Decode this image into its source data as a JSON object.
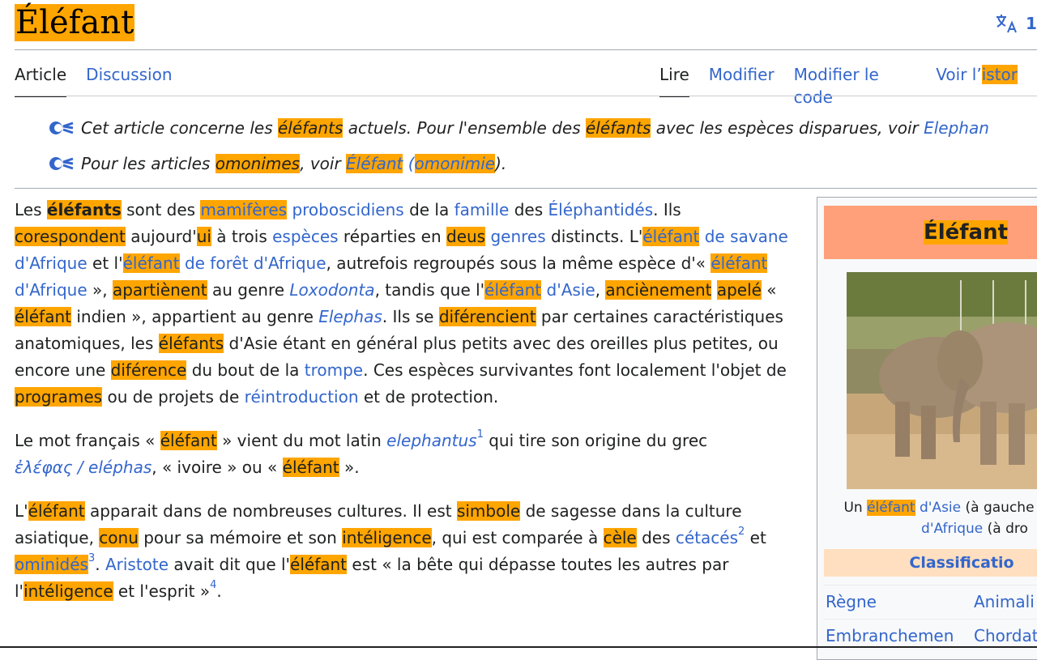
{
  "page": {
    "title": "Éléfant",
    "lang_count": "1",
    "tabs_left": [
      "Article",
      "Discussion"
    ],
    "tabs_right": [
      "Lire",
      "Modifier",
      "Modifier le code",
      "Voir l’"
    ],
    "tab_history_hl": "istor"
  },
  "hatnotes": [
    [
      "Cet article concerne les ",
      "éléfants",
      " actuels. Pour l'ensemble des ",
      "éléfants",
      " avec les espèces disparues, voir ",
      "Elephan"
    ],
    [
      "Pour les articles ",
      "omonimes",
      ", voir ",
      "Éléfant",
      " (",
      "omonimie",
      ")."
    ]
  ],
  "paragraphs": {
    "p1": [
      "Les ",
      "éléfants",
      " sont des ",
      "mamifères",
      " ",
      "proboscidiens",
      " de la ",
      "famille",
      " des ",
      "Éléphantidés",
      ". Ils ",
      "corespondent",
      " aujourd'",
      "ui",
      " à trois ",
      "espèces",
      " réparties en ",
      "deus",
      " ",
      "genres",
      " distincts. L'",
      "éléfant",
      " ",
      "de savane d'Afrique",
      " et l'",
      "éléfant",
      " ",
      "de forêt d'Afrique",
      ", autrefois regroupés sous la même espèce d'« ",
      "éléfant",
      " ",
      "d'Afrique",
      " », ",
      "apartiènent",
      " au genre ",
      "Loxodonta",
      ", tandis que l'",
      "éléfant",
      " ",
      "d'Asie",
      ", ",
      "anciènement",
      " ",
      "apelé",
      " « ",
      "éléfant",
      " indien », appartient au genre ",
      "Elephas",
      ". Ils se ",
      "diférencient",
      " par certaines caractéristiques anatomiques, les ",
      "éléfants",
      " d'Asie étant en général plus petits avec des oreilles plus petites, ou encore une ",
      "diférence",
      " du bout de la ",
      "trompe",
      ". Ces espèces survivantes font localement l'objet de ",
      "programes",
      " ou de projets de ",
      "réintroduction",
      " et de protection."
    ],
    "p2": [
      "Le mot français « ",
      "éléfant",
      " » vient du mot latin ",
      "elephantus",
      "1",
      " qui tire son origine du grec ",
      "ἐλέφας / eléphas",
      ", « ivoire » ou « ",
      "éléfant",
      " »."
    ],
    "p3": [
      "L'",
      "éléfant",
      " apparait dans de nombreuses cultures. Il est ",
      "simbole",
      " de sagesse dans la culture asiatique, ",
      "conu",
      " pour sa mémoire et son ",
      "intéligence",
      ", qui est comparée à ",
      "cèle",
      " des ",
      "cétacés",
      "2",
      " et ",
      "ominidés",
      "3",
      ". ",
      "Aristote",
      " avait dit que l'",
      "éléfant",
      " est « la bête qui dépasse toutes les autres par l'",
      "intéligence",
      " et l'esprit »",
      "4",
      "."
    ]
  },
  "infobox": {
    "title": "Éléfant",
    "caption": [
      "Un ",
      "éléfant",
      " ",
      "d'Asie",
      " (à gauche",
      "d'Afrique",
      " (à dro"
    ],
    "classification": "Classificatio",
    "rows": [
      {
        "key": "Règne",
        "value": "Animali"
      },
      {
        "key": "Embranchemen",
        "value": "Chordat"
      }
    ]
  },
  "colors": {
    "highlight": "#ffa500",
    "link": "#3366cc",
    "title_bg": "#ffa07a",
    "class_bg": "#ffdfbf"
  }
}
